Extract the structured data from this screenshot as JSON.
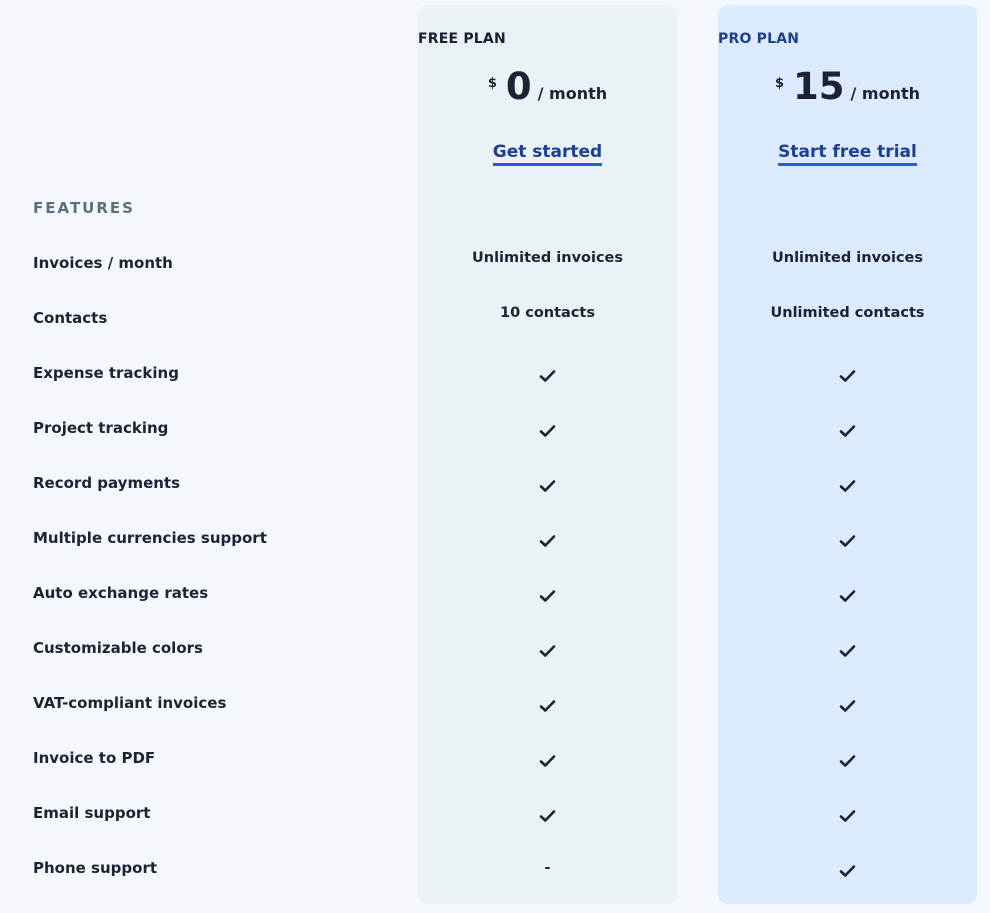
{
  "plans": {
    "free": {
      "name": "FREE PLAN",
      "currency": "$",
      "amount": "0",
      "period": "/ month",
      "cta": "Get started"
    },
    "pro": {
      "name": "PRO PLAN",
      "currency": "$",
      "amount": "15",
      "period": "/ month",
      "cta": "Start free trial"
    }
  },
  "features_heading": "FEATURES",
  "features": [
    {
      "label": "Invoices / month",
      "free": "Unlimited invoices",
      "pro": "Unlimited invoices"
    },
    {
      "label": "Contacts",
      "free": "10 contacts",
      "pro": "Unlimited contacts"
    },
    {
      "label": "Expense tracking",
      "free": "check",
      "pro": "check"
    },
    {
      "label": "Project tracking",
      "free": "check",
      "pro": "check"
    },
    {
      "label": "Record payments",
      "free": "check",
      "pro": "check"
    },
    {
      "label": "Multiple currencies support",
      "free": "check",
      "pro": "check"
    },
    {
      "label": "Auto exchange rates",
      "free": "check",
      "pro": "check"
    },
    {
      "label": "Customizable colors",
      "free": "check",
      "pro": "check"
    },
    {
      "label": "VAT-compliant invoices",
      "free": "check",
      "pro": "check"
    },
    {
      "label": "Invoice to PDF",
      "free": "check",
      "pro": "check"
    },
    {
      "label": "Email support",
      "free": "check",
      "pro": "check"
    },
    {
      "label": "Phone support",
      "free": "-",
      "pro": "check"
    }
  ]
}
